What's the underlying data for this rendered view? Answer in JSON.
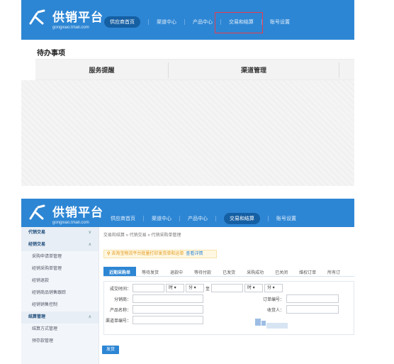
{
  "colors": {
    "brand_blue": "#2d86d4",
    "active_nav": "#155fa3",
    "highlight_red": "#ea3a4b",
    "notice_orange": "#e39a1c"
  },
  "logo": {
    "title": "供销平台",
    "subtitle": "gongxiao.tmall.com",
    "icon": "logo-mark-icon"
  },
  "top_nav": {
    "items": [
      "供应商首页",
      "渠道中心",
      "产品中心",
      "交易和结算",
      "账号设置"
    ]
  },
  "todo": {
    "title": "待办事项",
    "columns": [
      "服务提醒",
      "渠道管理"
    ]
  },
  "sidebar": {
    "groups": [
      {
        "label": "代销交易",
        "items": []
      },
      {
        "label": "经销交易",
        "items": [
          "采购申请单管理",
          "经销采购单管理",
          "经销退款",
          "经销商品销售跟踪",
          "经销销售控制"
        ]
      },
      {
        "label": "结算管理",
        "items": [
          "结算方式管理",
          "预存款管理"
        ]
      }
    ]
  },
  "breadcrumb": "交易和结算 » 代销交易 » 代销采购单管理",
  "notice": {
    "text": "去淘宝物流平台批量打印发货单和运单",
    "link": "查看详情"
  },
  "order_tabs": [
    "近期采购单",
    "等待发货",
    "退款中",
    "等待付款",
    "已发货",
    "采购成功",
    "已关闭",
    "维权订单",
    "所有订"
  ],
  "form": {
    "deal_time_label": "成交时间：",
    "hour_unit": "时",
    "minute_unit": "分",
    "to_label": "至",
    "distributor_label": "分销商：",
    "product_label": "产品名称：",
    "channel_order_label": "渠道单编号：",
    "order_no_label": "订单编号：",
    "recipient_label": "收货人：",
    "hour_from": "",
    "minute_from": "",
    "hour_to": "",
    "minute_to": ""
  },
  "send_button": "发货"
}
